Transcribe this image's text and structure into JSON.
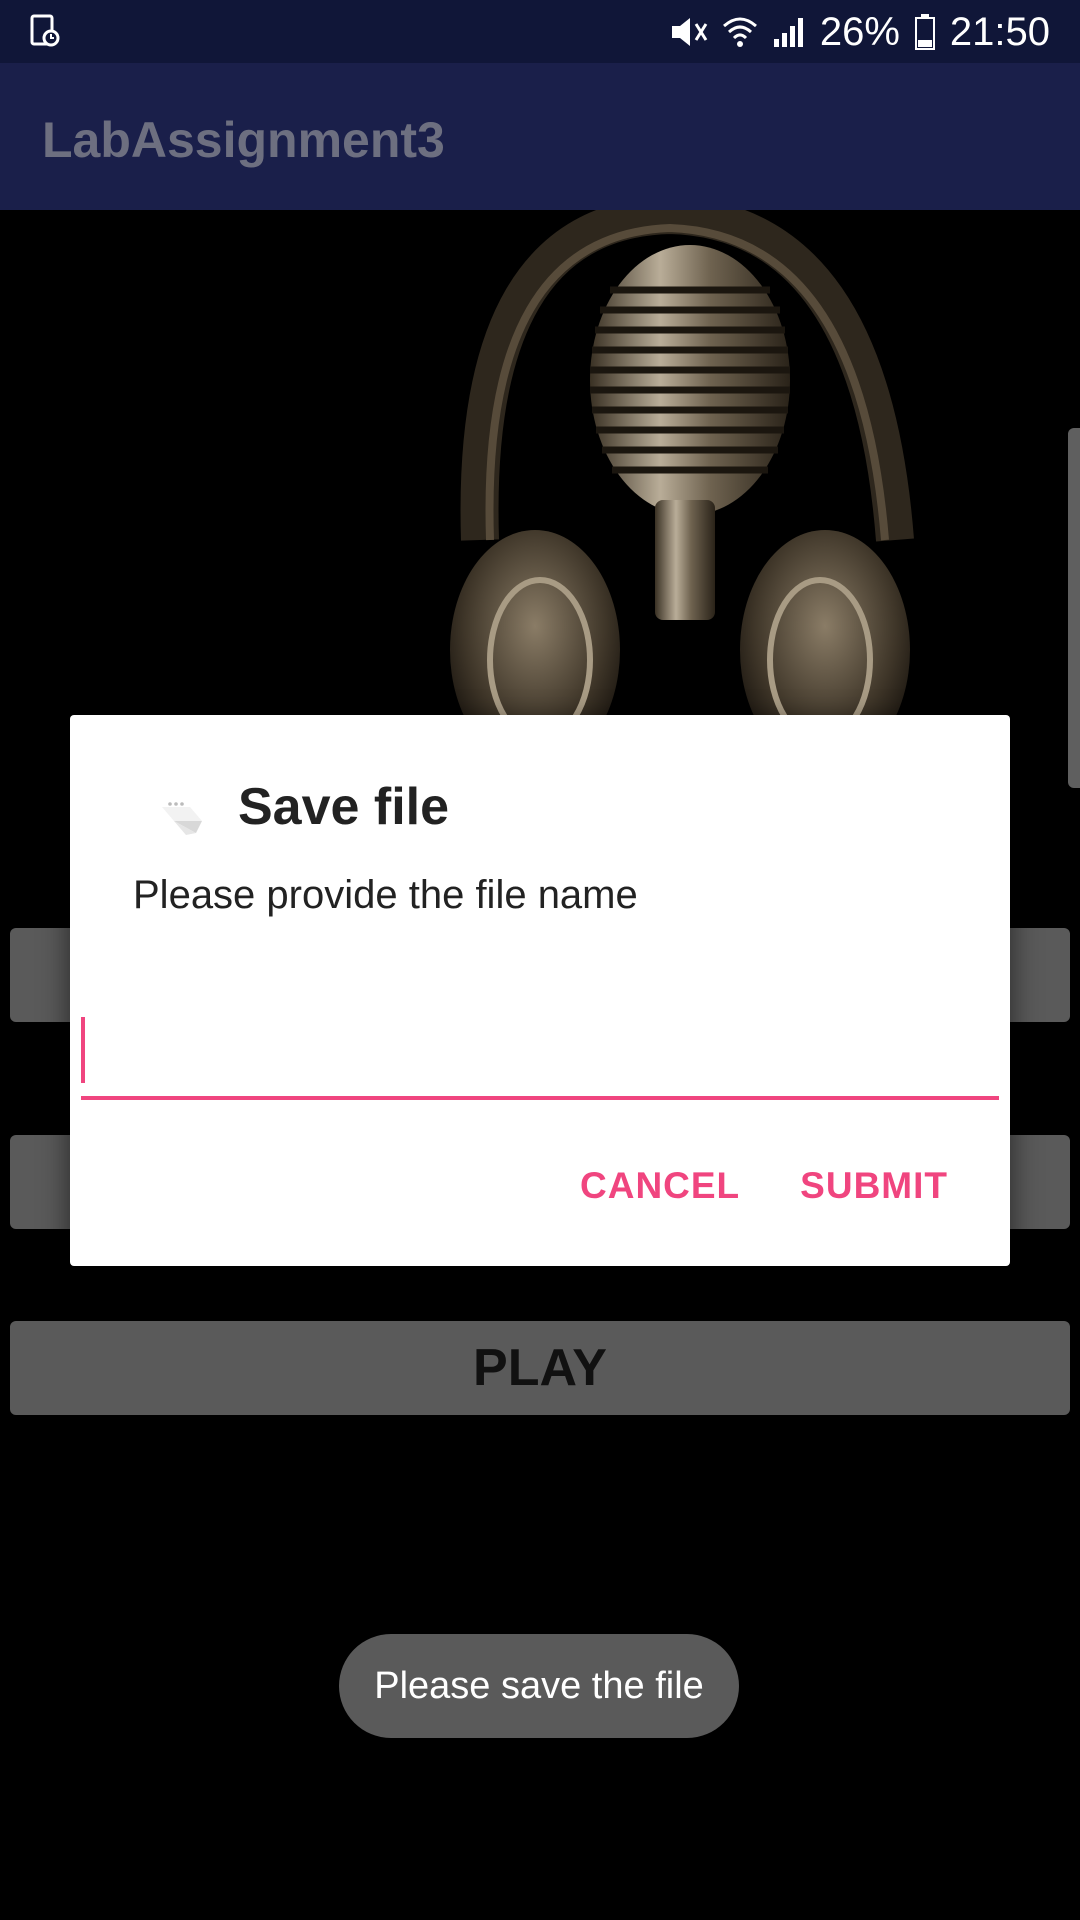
{
  "status_bar": {
    "battery_percent": "26%",
    "time": "21:50",
    "icons": [
      "screen-record-icon",
      "mute-icon",
      "wifi-icon",
      "signal-icon",
      "battery-icon"
    ]
  },
  "app_bar": {
    "title": "LabAssignment3"
  },
  "content": {
    "image": "microphone-headphones-image",
    "play_label": "PLAY"
  },
  "dialog": {
    "title": "Save file",
    "icon": "file-icon",
    "message": "Please provide the file name",
    "input_value": "",
    "input_placeholder": "",
    "cancel_label": "CANCEL",
    "submit_label": "SUBMIT",
    "accent_color": "#f0457f"
  },
  "toast": {
    "message": "Please save the file"
  }
}
